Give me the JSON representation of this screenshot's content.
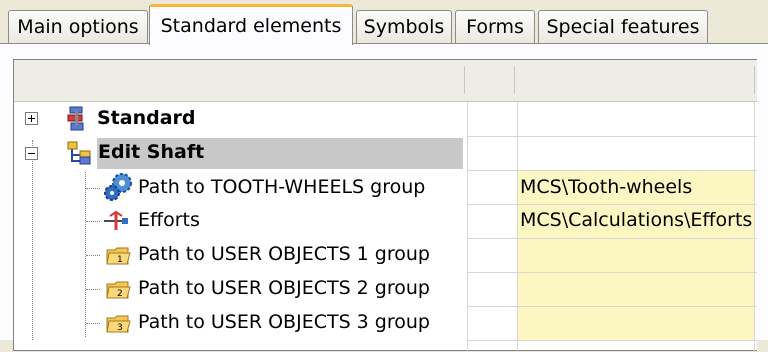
{
  "tabs": [
    {
      "label": "Main options",
      "active": false
    },
    {
      "label": "Standard elements",
      "active": true
    },
    {
      "label": "Symbols",
      "active": false
    },
    {
      "label": "Forms",
      "active": false
    },
    {
      "label": "Special features",
      "active": false
    }
  ],
  "tree": {
    "standard": {
      "label": "Standard",
      "expanded": false
    },
    "edit_shaft": {
      "label": "Edit Shaft",
      "expanded": true,
      "selected": true
    },
    "children": [
      {
        "label": "Path to TOOTH-WHEELS group",
        "value": "MCS\\Tooth-wheels",
        "icon": "gears-icon"
      },
      {
        "label": "Efforts",
        "value": "MCS\\Calculations\\Efforts",
        "icon": "efforts-icon"
      },
      {
        "label": "Path to USER OBJECTS 1 group",
        "value": "",
        "icon": "folder-1-icon"
      },
      {
        "label": "Path to USER OBJECTS 2 group",
        "value": "",
        "icon": "folder-2-icon"
      },
      {
        "label": "Path to USER OBJECTS 3 group",
        "value": "",
        "icon": "folder-3-icon"
      }
    ]
  },
  "folder_numbers": [
    "1",
    "2",
    "3"
  ],
  "colors": {
    "accent_tab": "#f5b83a",
    "value_bg": "#fcf7c2",
    "selection": "#c8c8c8"
  }
}
